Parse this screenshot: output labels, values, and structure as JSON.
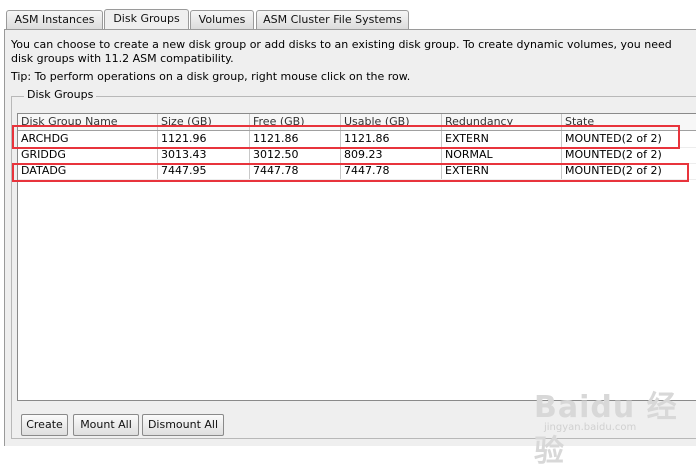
{
  "tabs": [
    {
      "label": "ASM Instances"
    },
    {
      "label": "Disk Groups"
    },
    {
      "label": "Volumes"
    },
    {
      "label": "ASM Cluster File Systems"
    }
  ],
  "active_tab": "Disk Groups",
  "description": "You can choose to create a new disk group or add disks to an existing disk group. To create dynamic volumes, you need disk groups with 11.2 ASM compatibility.",
  "tip": "Tip: To perform operations on a disk group, right mouse click on the row.",
  "group_title": "Disk Groups",
  "table": {
    "columns": [
      "Disk Group Name",
      "Size (GB)",
      "Free (GB)",
      "Usable (GB)",
      "Redundancy",
      "State"
    ],
    "rows": [
      [
        "ARCHDG",
        "1121.96",
        "1121.86",
        "1121.86",
        "EXTERN",
        "MOUNTED(2 of 2)"
      ],
      [
        "GRIDDG",
        "3013.43",
        "3012.50",
        "809.23",
        "NORMAL",
        "MOUNTED(2 of 2)"
      ],
      [
        "DATADG",
        "7447.95",
        "7447.78",
        "7447.78",
        "EXTERN",
        "MOUNTED(2 of 2)"
      ]
    ],
    "highlighted_rows": [
      "ARCHDG",
      "DATADG"
    ],
    "highlight_color": "#e8343c"
  },
  "buttons": {
    "create": "Create",
    "mount_all": "Mount All",
    "dismount_all": "Dismount All"
  },
  "watermark": {
    "logo": "Baidu 经验",
    "url": "jingyan.baidu.com"
  }
}
